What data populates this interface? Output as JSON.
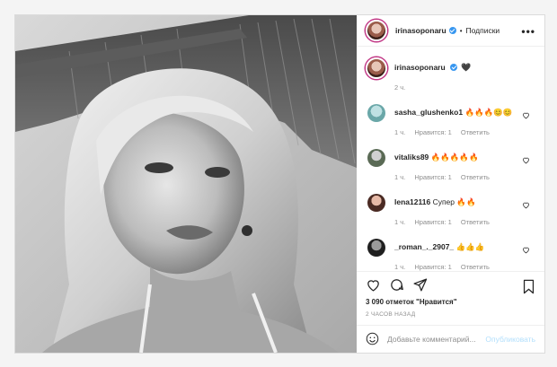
{
  "post": {
    "header": {
      "username": "irinasoponaru",
      "separator": "•",
      "follow_label": "Подписки",
      "more_icon": "more-horizontal-icon"
    },
    "caption": {
      "username": "irinasoponaru",
      "text": "🖤",
      "time": "2 ч."
    },
    "comments": [
      {
        "username": "sasha_glushenko1",
        "text": "🔥🔥🔥😊😊",
        "time": "1 ч.",
        "likes": "Нравится: 1",
        "reply": "Ответить"
      },
      {
        "username": "vitaliks89",
        "text": "🔥🔥🔥🔥🔥",
        "time": "1 ч.",
        "likes": "Нравится: 1",
        "reply": "Ответить"
      },
      {
        "username": "lena12116",
        "text": "Супер 🔥🔥",
        "time": "1 ч.",
        "likes": "Нравится: 1",
        "reply": "Ответить"
      },
      {
        "username": "_roman_._2907_",
        "text": "👍👍👍",
        "time": "1 ч.",
        "likes": "Нравится: 1",
        "reply": "Ответить"
      }
    ],
    "likes_text": "3 090 отметок \"Нравится\"",
    "time_ago": "2 ЧАСОВ НАЗАД",
    "add_comment": {
      "placeholder": "Добавьте комментарий...",
      "publish": "Опубликовать"
    },
    "icons": {
      "like": "heart-icon",
      "comment": "comment-icon",
      "share": "share-icon",
      "save": "bookmark-icon",
      "emoji": "emoji-icon"
    },
    "colors": {
      "verified": "#3897f0",
      "publish_disabled": "#b2dffc",
      "muted": "#8e8e8e"
    }
  }
}
